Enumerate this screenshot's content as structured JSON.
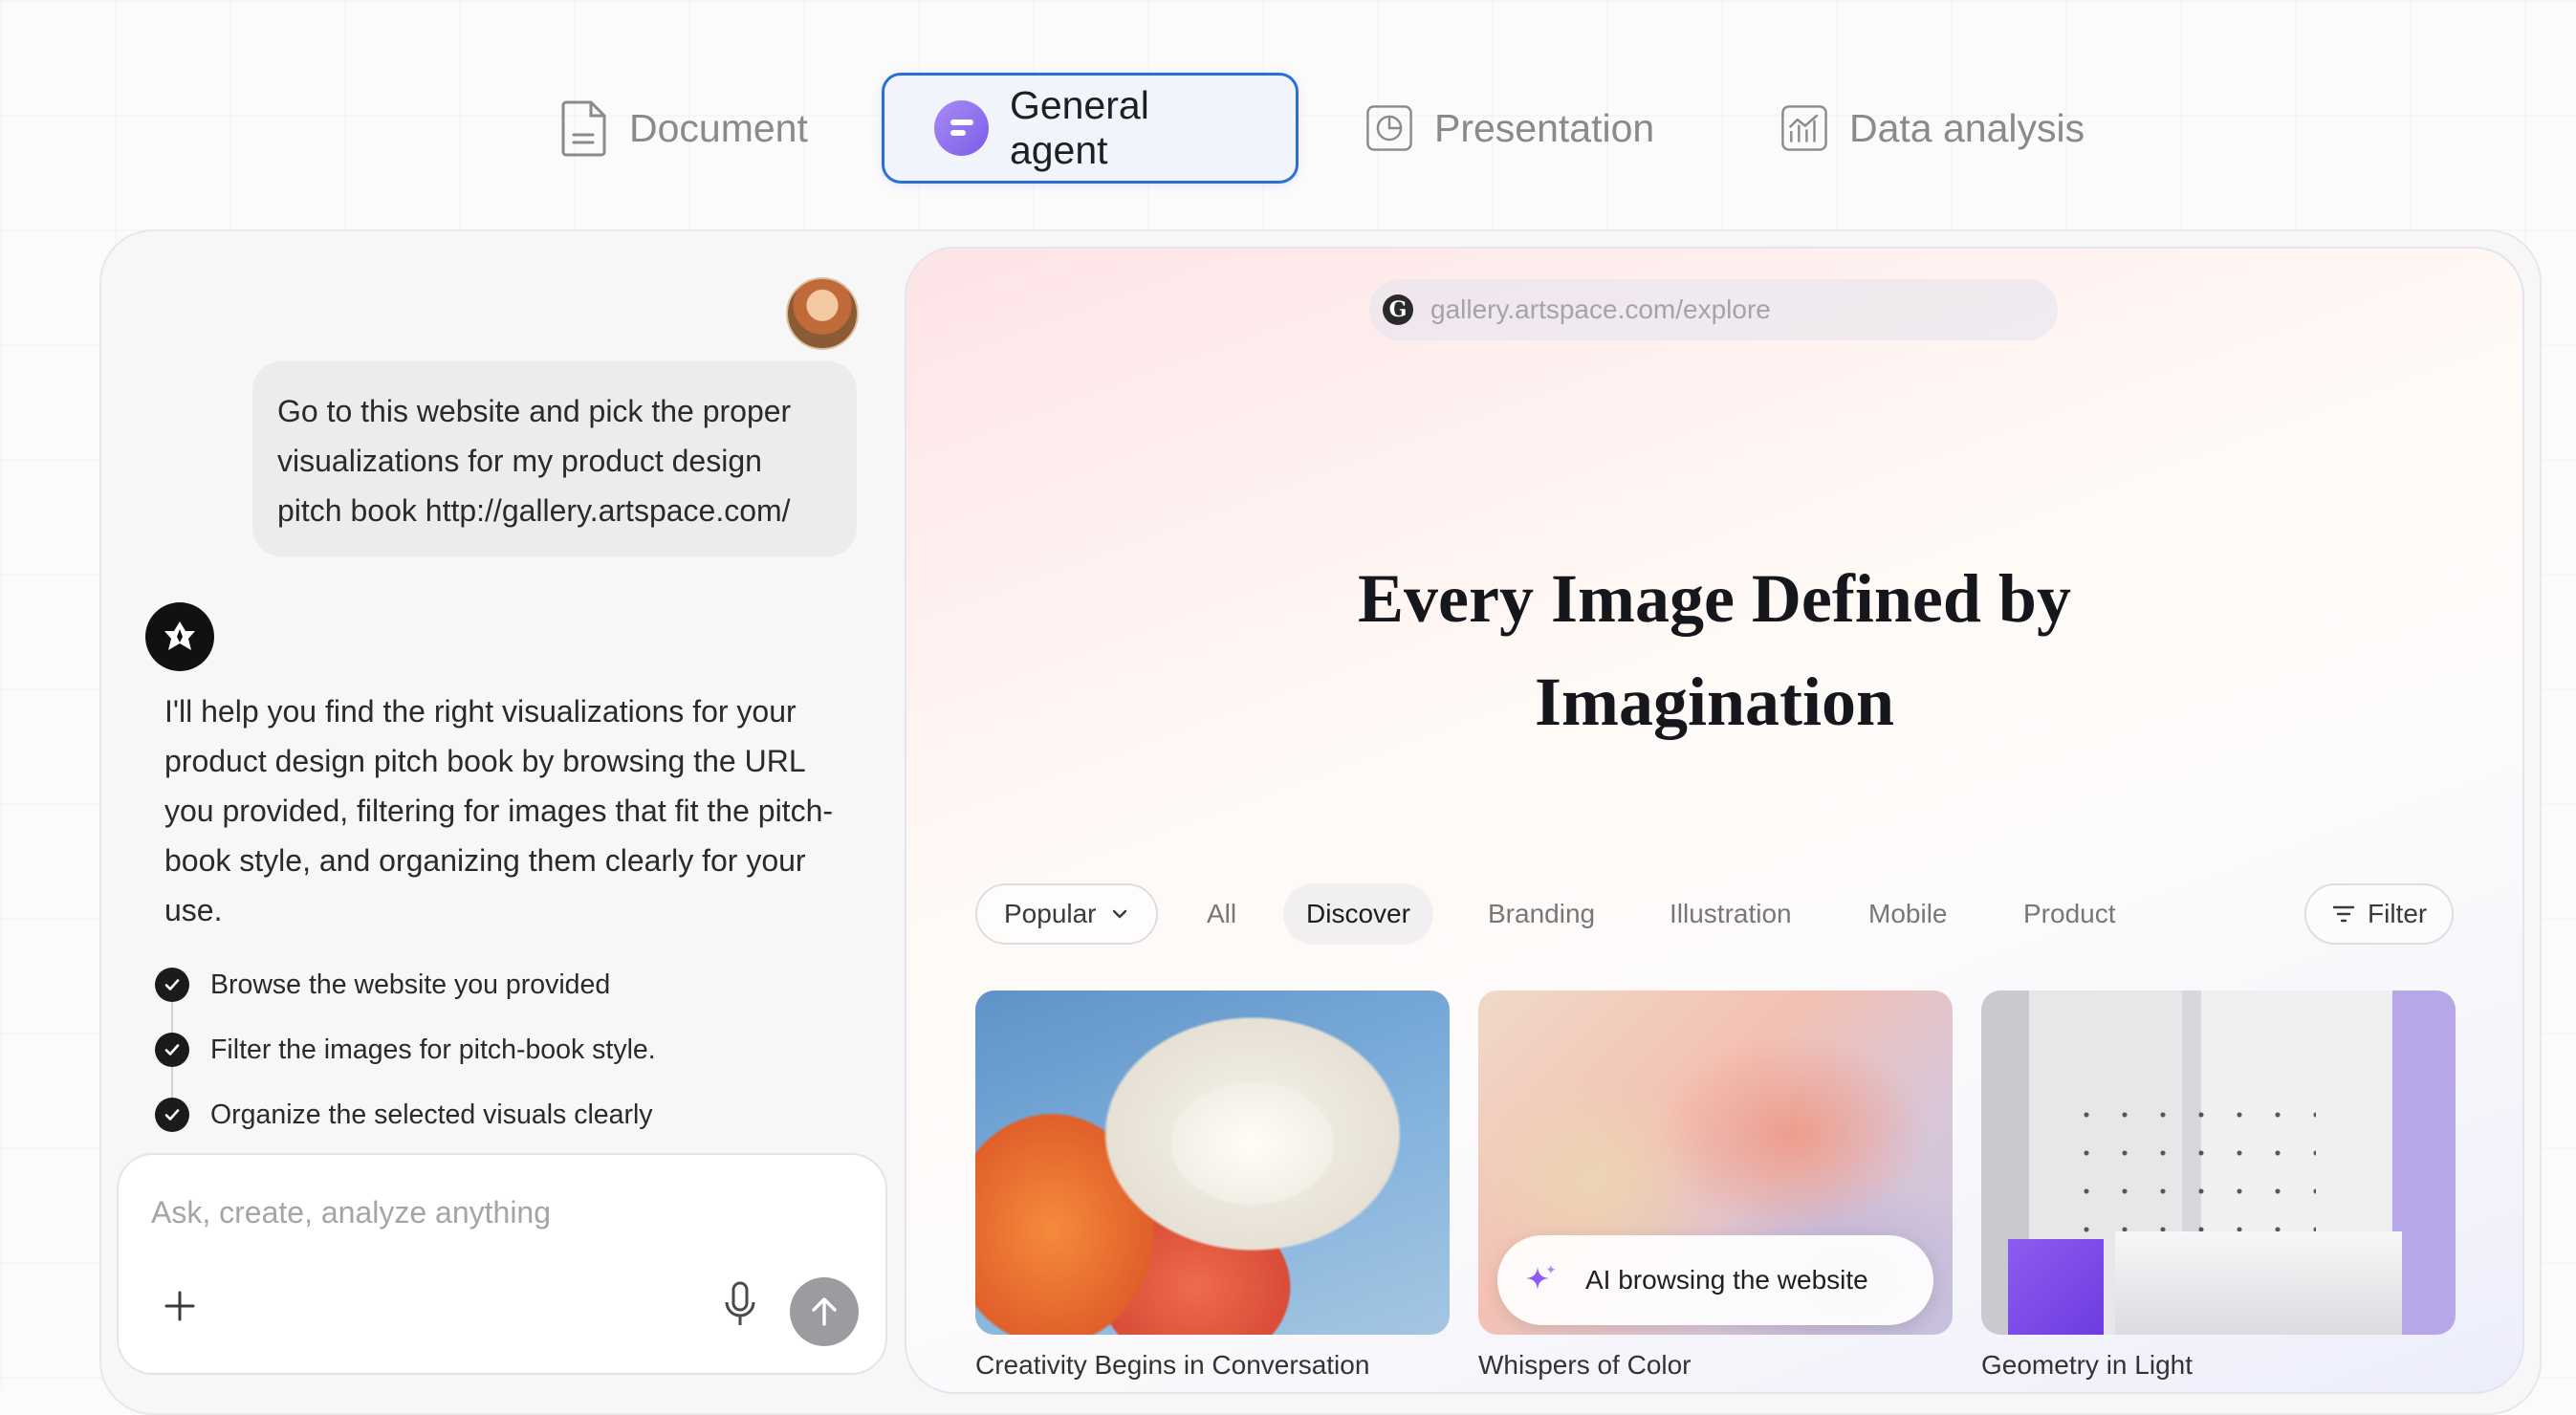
{
  "tabs": [
    {
      "label": "Document",
      "icon": "document-icon"
    },
    {
      "label": "General agent",
      "icon": "agent-chat-icon",
      "active": true
    },
    {
      "label": "Presentation",
      "icon": "presentation-icon"
    },
    {
      "label": "Data analysis",
      "icon": "data-analysis-icon"
    }
  ],
  "chat": {
    "user_message": "Go to this website and pick the proper visualizations for my product design pitch book http://gallery.artspace.com/",
    "assistant_message": "I'll help you find the right visualizations for your product design pitch book by browsing the URL you provided, filtering for images that fit the pitch-book style, and organizing them clearly for your use.",
    "steps": [
      "Browse the website you provided",
      "Filter the images for pitch-book style.",
      "Organize the selected visuals clearly"
    ],
    "composer_placeholder": "Ask, create, analyze anything"
  },
  "browser": {
    "url": "gallery.artspace.com/explore",
    "site_icon_letter": "G",
    "hero_line1": "Every Image Defined by",
    "hero_line2": "Imagination",
    "sort_label": "Popular",
    "categories": [
      "All",
      "Discover",
      "Branding",
      "Illustration",
      "Mobile",
      "Product"
    ],
    "selected_category": "Discover",
    "filter_label": "Filter",
    "cards": [
      {
        "caption": "Creativity Begins in Conversation"
      },
      {
        "caption": "Whispers of Color"
      },
      {
        "caption": "Geometry in Light"
      }
    ],
    "ai_status": "AI browsing the website"
  },
  "colors": {
    "active_tab_border": "#2b6fd6",
    "agent_icon": "#8b6cf0",
    "send_button": "#9c9ca0",
    "ai_sparkle": "#8b5cf6"
  }
}
